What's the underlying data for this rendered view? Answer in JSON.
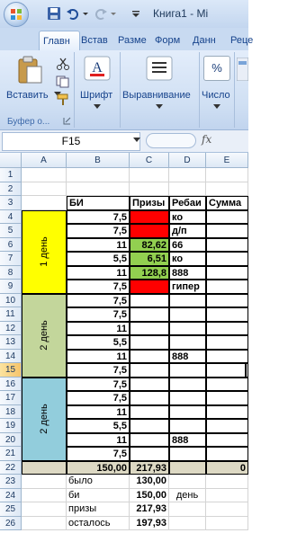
{
  "window": {
    "title": "Книга1 - Mi"
  },
  "ribbon": {
    "tabs": [
      "Главн",
      "Встав",
      "Разме",
      "Форм",
      "Данн",
      "Реце"
    ],
    "paste_label": "Вставить",
    "clipboard_label": "Буфер о...",
    "font_label": "Шрифт",
    "align_label": "Выравнивание",
    "number_label": "Число",
    "number_symbol": "%"
  },
  "formula_bar": {
    "name_box": "F15",
    "fx": "fx",
    "value": ""
  },
  "sheet": {
    "columns": [
      "A",
      "B",
      "C",
      "D",
      "E"
    ],
    "rows": [
      "1",
      "2",
      "3",
      "4",
      "5",
      "6",
      "7",
      "8",
      "9",
      "10",
      "11",
      "12",
      "13",
      "14",
      "15",
      "16",
      "17",
      "18",
      "19",
      "20",
      "21",
      "22",
      "23",
      "24",
      "25",
      "26"
    ],
    "headers": {
      "b": "БИ",
      "c": "Призы",
      "d": "Ребаи",
      "e": "Сумма"
    },
    "day_labels": [
      "1 день",
      "2 день",
      "2 день"
    ],
    "data": [
      {
        "row": 4,
        "b": "7,5",
        "c": "",
        "d": "ко"
      },
      {
        "row": 5,
        "b": "7,5",
        "c": "",
        "d": "д/п"
      },
      {
        "row": 6,
        "b": "11",
        "c": "82,62",
        "d": "66"
      },
      {
        "row": 7,
        "b": "5,5",
        "c": "6,51",
        "d": "ко"
      },
      {
        "row": 8,
        "b": "11",
        "c": "128,8",
        "d": "888"
      },
      {
        "row": 9,
        "b": "7,5",
        "c": "",
        "d": "гипер"
      },
      {
        "row": 10,
        "b": "7,5",
        "c": "",
        "d": ""
      },
      {
        "row": 11,
        "b": "7,5",
        "c": "",
        "d": ""
      },
      {
        "row": 12,
        "b": "11",
        "c": "",
        "d": ""
      },
      {
        "row": 13,
        "b": "5,5",
        "c": "",
        "d": ""
      },
      {
        "row": 14,
        "b": "11",
        "c": "",
        "d": "888"
      },
      {
        "row": 15,
        "b": "7,5",
        "c": "",
        "d": ""
      },
      {
        "row": 16,
        "b": "7,5",
        "c": "",
        "d": ""
      },
      {
        "row": 17,
        "b": "7,5",
        "c": "",
        "d": ""
      },
      {
        "row": 18,
        "b": "11",
        "c": "",
        "d": ""
      },
      {
        "row": 19,
        "b": "5,5",
        "c": "",
        "d": ""
      },
      {
        "row": 20,
        "b": "11",
        "c": "",
        "d": "888"
      },
      {
        "row": 21,
        "b": "7,5",
        "c": "",
        "d": ""
      }
    ],
    "totals": {
      "b": "150,00",
      "c": "217,93",
      "e": "0"
    },
    "summary": [
      {
        "label": "было",
        "value": "130,00",
        "extra": ""
      },
      {
        "label": "би",
        "value": "150,00",
        "extra": "день"
      },
      {
        "label": "призы",
        "value": "217,93",
        "extra": ""
      },
      {
        "label": "осталось",
        "value": "197,93",
        "extra": ""
      }
    ]
  },
  "colors": {
    "yellow": "#ffff00",
    "green_day": "#c3d69b",
    "blue_day": "#92cddc",
    "red": "#ff0000",
    "green_cell": "#92d050",
    "totals_bg": "#ddd9c4"
  }
}
